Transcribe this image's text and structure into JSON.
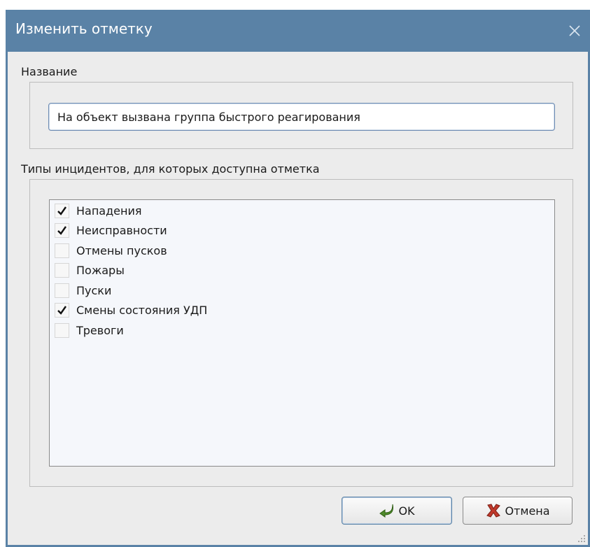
{
  "window": {
    "title": "Изменить отметку"
  },
  "name_section": {
    "label": "Название",
    "value": "На объект вызвана группа быстрого реагирования"
  },
  "types_section": {
    "label": "Типы инцидентов, для которых доступна отметка",
    "items": [
      {
        "label": "Нападения",
        "checked": true
      },
      {
        "label": "Неисправности",
        "checked": true
      },
      {
        "label": "Отмены пусков",
        "checked": false
      },
      {
        "label": "Пожары",
        "checked": false
      },
      {
        "label": "Пуски",
        "checked": false
      },
      {
        "label": "Смены состояния УДП",
        "checked": true
      },
      {
        "label": "Тревоги",
        "checked": false
      }
    ]
  },
  "buttons": {
    "ok_label": "OK",
    "cancel_label": "Отмена"
  },
  "icons": {
    "close": "close-icon",
    "ok": "ok-arrow-icon",
    "cancel": "cancel-x-icon",
    "check": "checkmark-icon"
  },
  "colors": {
    "titlebar": "#5a82a6",
    "client": "#ececec",
    "list_bg": "#f5f7fb"
  }
}
